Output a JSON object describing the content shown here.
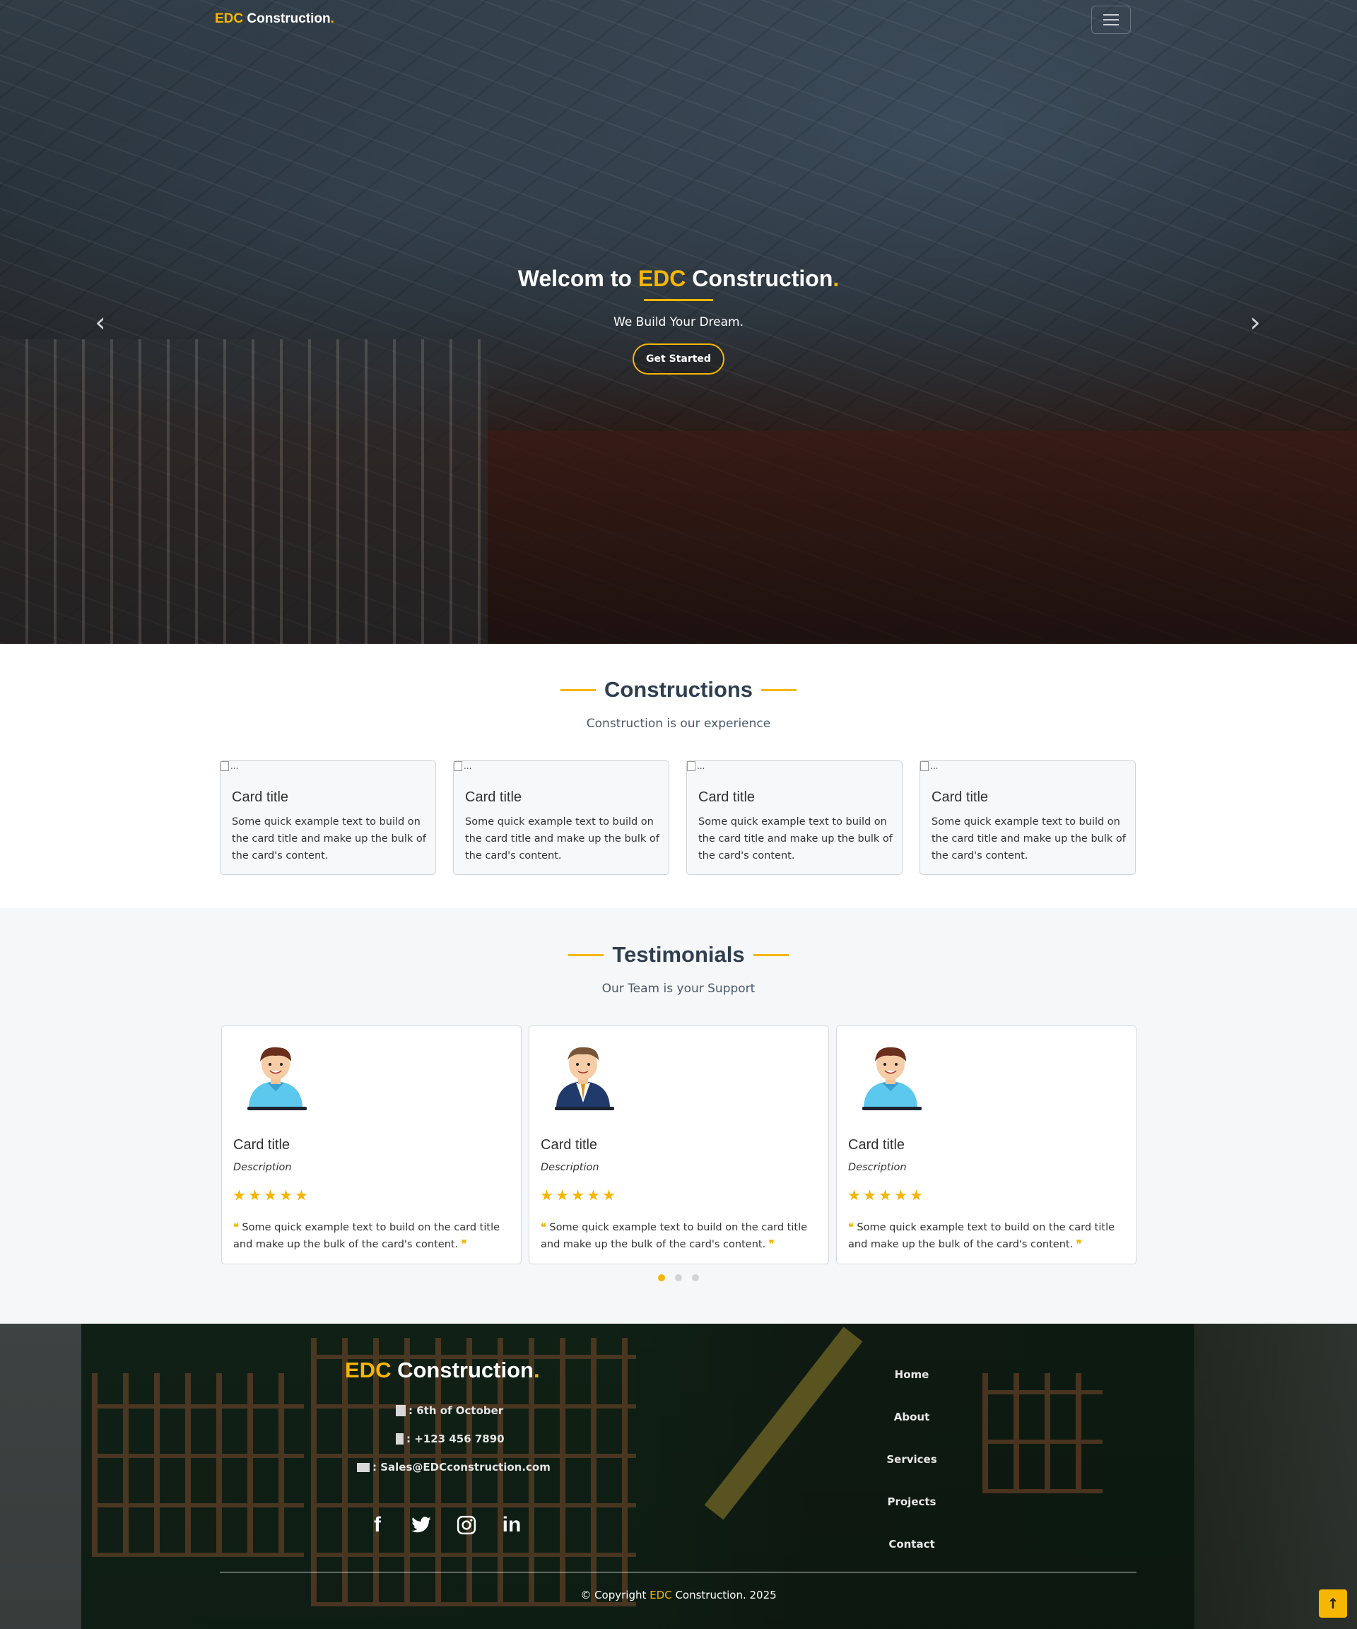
{
  "brand": {
    "edc": "EDC",
    "name": " Construction",
    "dot": "."
  },
  "hero": {
    "title_prefix": "Welcom to ",
    "title_edc": "EDC",
    "title_suffix": " Construction",
    "title_dot": ".",
    "subtitle": "We Build Your Dream.",
    "button": "Get Started",
    "prev_icon": "chevron-left-icon",
    "next_icon": "chevron-right-icon"
  },
  "constructions": {
    "title": "Constructions",
    "subtitle": "Construction is our experience",
    "cards": [
      {
        "alt": "...",
        "title": "Card title",
        "text": "Some quick example text to build on the card title and make up the bulk of the card's content."
      },
      {
        "alt": "...",
        "title": "Card title",
        "text": "Some quick example text to build on the card title and make up the bulk of the card's content."
      },
      {
        "alt": "...",
        "title": "Card title",
        "text": "Some quick example text to build on the card title and make up the bulk of the card's content."
      },
      {
        "alt": "...",
        "title": "Card title",
        "text": "Some quick example text to build on the card title and make up the bulk of the card's content."
      }
    ]
  },
  "testimonials": {
    "title": "Testimonials",
    "subtitle": "Our Team is your Support",
    "cards": [
      {
        "title": "Card title",
        "description": "Description",
        "rating": 5,
        "quote": "Some quick example text to build on the card title and make up the bulk of the card's content.",
        "avatar": "casual-man-avatar"
      },
      {
        "title": "Card title",
        "description": "Description",
        "rating": 5,
        "quote": "Some quick example text to build on the card title and make up the bulk of the card's content.",
        "avatar": "suit-man-avatar"
      },
      {
        "title": "Card title",
        "description": "Description",
        "rating": 5,
        "quote": "Some quick example text to build on the card title and make up the bulk of the card's content.",
        "avatar": "casual-man-avatar"
      }
    ],
    "slides": 3,
    "active_slide": 1
  },
  "footer": {
    "brand_edc": "EDC",
    "brand_name": " Construction",
    "brand_dot": ".",
    "address": ": 6th of October",
    "phone": ": +123 456 7890",
    "email": ": Sales@EDCconstruction.com",
    "socials": [
      "facebook-icon",
      "twitter-icon",
      "instagram-icon",
      "linkedin-icon"
    ],
    "nav": [
      "Home",
      "About",
      "Services",
      "Projects",
      "Contact"
    ],
    "copyright_prefix": "© Copyright ",
    "copyright_edc": "EDC",
    "copyright_suffix": " Construction. 2025"
  },
  "colors": {
    "accent": "#f7b602",
    "heading": "#2f3f4f"
  }
}
